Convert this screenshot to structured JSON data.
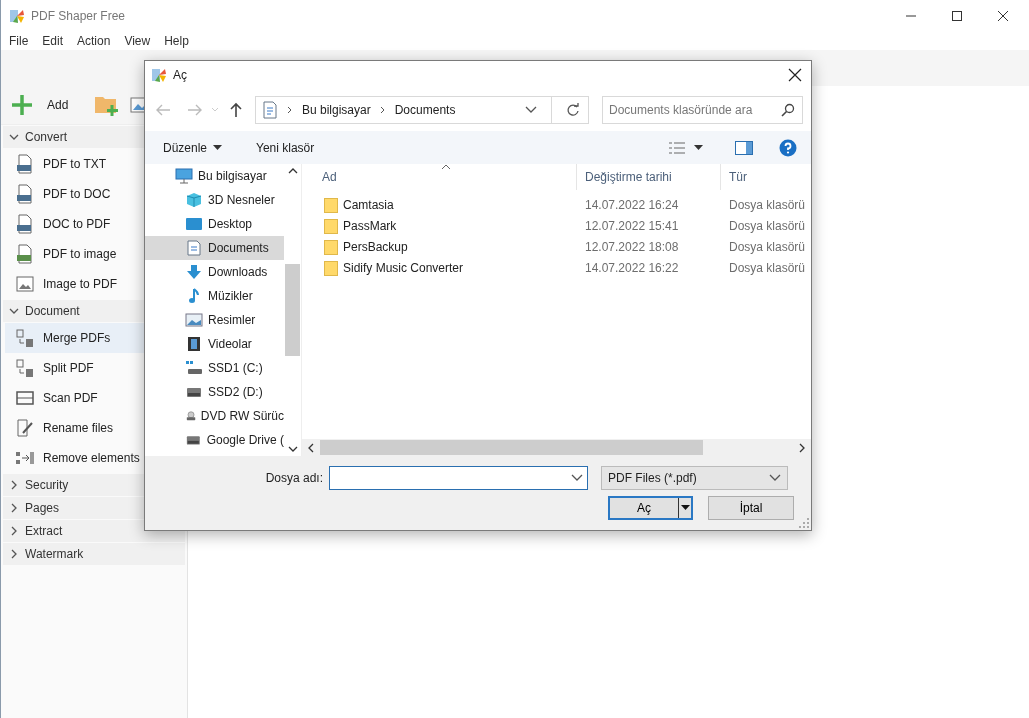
{
  "app": {
    "title": "PDF Shaper Free",
    "menu": [
      "File",
      "Edit",
      "Action",
      "View",
      "Help"
    ],
    "toolbar": {
      "add_label": "Add"
    }
  },
  "sidebar": {
    "groups": [
      {
        "label": "Convert",
        "expanded": true,
        "items": [
          {
            "label": "PDF to TXT",
            "kind": "txt",
            "selected": false
          },
          {
            "label": "PDF to DOC",
            "kind": "doc",
            "selected": false
          },
          {
            "label": "DOC to PDF",
            "kind": "word",
            "selected": false
          },
          {
            "label": "PDF to image",
            "kind": "jpg",
            "selected": false
          },
          {
            "label": "Image to PDF",
            "kind": "image",
            "selected": false
          }
        ]
      },
      {
        "label": "Document",
        "expanded": true,
        "items": [
          {
            "label": "Merge PDFs",
            "kind": "merge",
            "selected": true
          },
          {
            "label": "Split PDF",
            "kind": "split",
            "selected": false
          },
          {
            "label": "Scan PDF",
            "kind": "scan",
            "selected": false
          },
          {
            "label": "Rename files",
            "kind": "rename",
            "selected": false
          },
          {
            "label": "Remove elements",
            "kind": "remove",
            "selected": false
          }
        ]
      },
      {
        "label": "Security",
        "expanded": false
      },
      {
        "label": "Pages",
        "expanded": false
      },
      {
        "label": "Extract",
        "expanded": false
      },
      {
        "label": "Watermark",
        "expanded": false
      }
    ]
  },
  "dialog": {
    "title": "Aç",
    "path": [
      "Bu bilgisayar",
      "Documents"
    ],
    "search": {
      "placeholder": "Documents klasöründe ara"
    },
    "commands": {
      "organize": "Düzenle",
      "new_folder": "Yeni klasör"
    },
    "tree": [
      {
        "label": "Bu bilgisayar",
        "selected": false,
        "children": [
          {
            "label": "3D Nesneler",
            "kind": "cube",
            "selected": false
          },
          {
            "label": "Desktop",
            "kind": "desktop",
            "selected": false
          },
          {
            "label": "Documents",
            "kind": "documents",
            "selected": true
          },
          {
            "label": "Downloads",
            "kind": "downloads",
            "selected": false
          },
          {
            "label": "Müzikler",
            "kind": "music",
            "selected": false
          },
          {
            "label": "Resimler",
            "kind": "pictures",
            "selected": false
          },
          {
            "label": "Videolar",
            "kind": "videos",
            "selected": false
          },
          {
            "label": "SSD1 (C:)",
            "kind": "system-drive",
            "selected": false
          },
          {
            "label": "SSD2 (D:)",
            "kind": "drive",
            "selected": false
          },
          {
            "label": "DVD RW Sürüc",
            "kind": "dvd",
            "selected": false
          },
          {
            "label": "Google Drive (",
            "kind": "drive",
            "selected": false
          }
        ]
      }
    ],
    "columns": [
      "Ad",
      "Değiştirme tarihi",
      "Tür"
    ],
    "rows": [
      {
        "name": "Camtasia",
        "date": "14.07.2022 16:24",
        "type": "Dosya klasörü"
      },
      {
        "name": "PassMark",
        "date": "12.07.2022 15:41",
        "type": "Dosya klasörü"
      },
      {
        "name": "PersBackup",
        "date": "12.07.2022 18:08",
        "type": "Dosya klasörü"
      },
      {
        "name": "Sidify Music Converter",
        "date": "14.07.2022 16:22",
        "type": "Dosya klasörü"
      }
    ],
    "filename": {
      "label": "Dosya adı:"
    },
    "filter": "PDF Files (*.pdf)",
    "buttons": {
      "open": "Aç",
      "cancel": "İptal"
    }
  }
}
